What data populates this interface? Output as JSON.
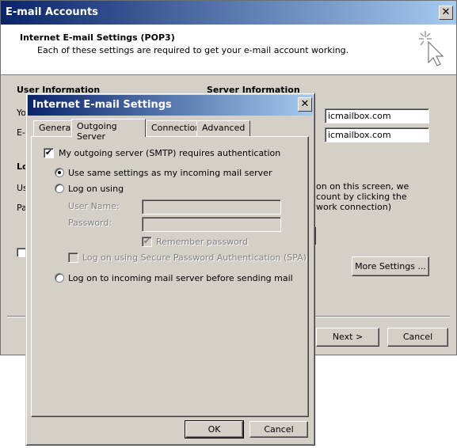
{
  "outer": {
    "title": "E-mail Accounts",
    "close_glyph": "✕",
    "header_title": "Internet E-mail Settings (POP3)",
    "header_subtitle": "Each of these settings are required to get your e-mail account working.",
    "user_information_label": "User Information",
    "server_information_label": "Server Information",
    "incoming_server": "icmailbox.com",
    "outgoing_server": "icmailbox.com",
    "left_fragments": [
      "Yo",
      "E-",
      "Lo",
      "Us",
      "Pa"
    ],
    "right_text": [
      "on on this screen, we",
      "count by clicking the",
      "work connection)"
    ],
    "more_settings_label": "More Settings ...",
    "next_label": "Next >",
    "cancel_label": "Cancel"
  },
  "inner": {
    "title": "Internet E-mail Settings",
    "close_glyph": "✕",
    "tabs": [
      "General",
      "Outgoing Server",
      "Connection",
      "Advanced"
    ],
    "active_tab": "Outgoing Server",
    "smtp_auth_label": "My outgoing server (SMTP) requires authentication",
    "smtp_auth_checked": true,
    "radio_same_label": "Use same settings as my incoming mail server",
    "radio_logon_label": "Log on using",
    "user_name_label": "User Name:",
    "password_label": "Password:",
    "user_name_value": "",
    "password_value": "",
    "remember_password_label": "Remember password",
    "spa_label": "Log on using Secure Password Authentication (SPA)",
    "radio_incoming_label": "Log on to incoming mail server before sending mail",
    "ok_label": "OK",
    "cancel_label": "Cancel"
  },
  "icons": {
    "header_icon": "cursor-sparkle-icon",
    "check_glyph": "✔"
  },
  "colors": {
    "titlebar_start": "#0a246a",
    "titlebar_end": "#a6caf0",
    "dialog_face": "#d4d0c8"
  }
}
